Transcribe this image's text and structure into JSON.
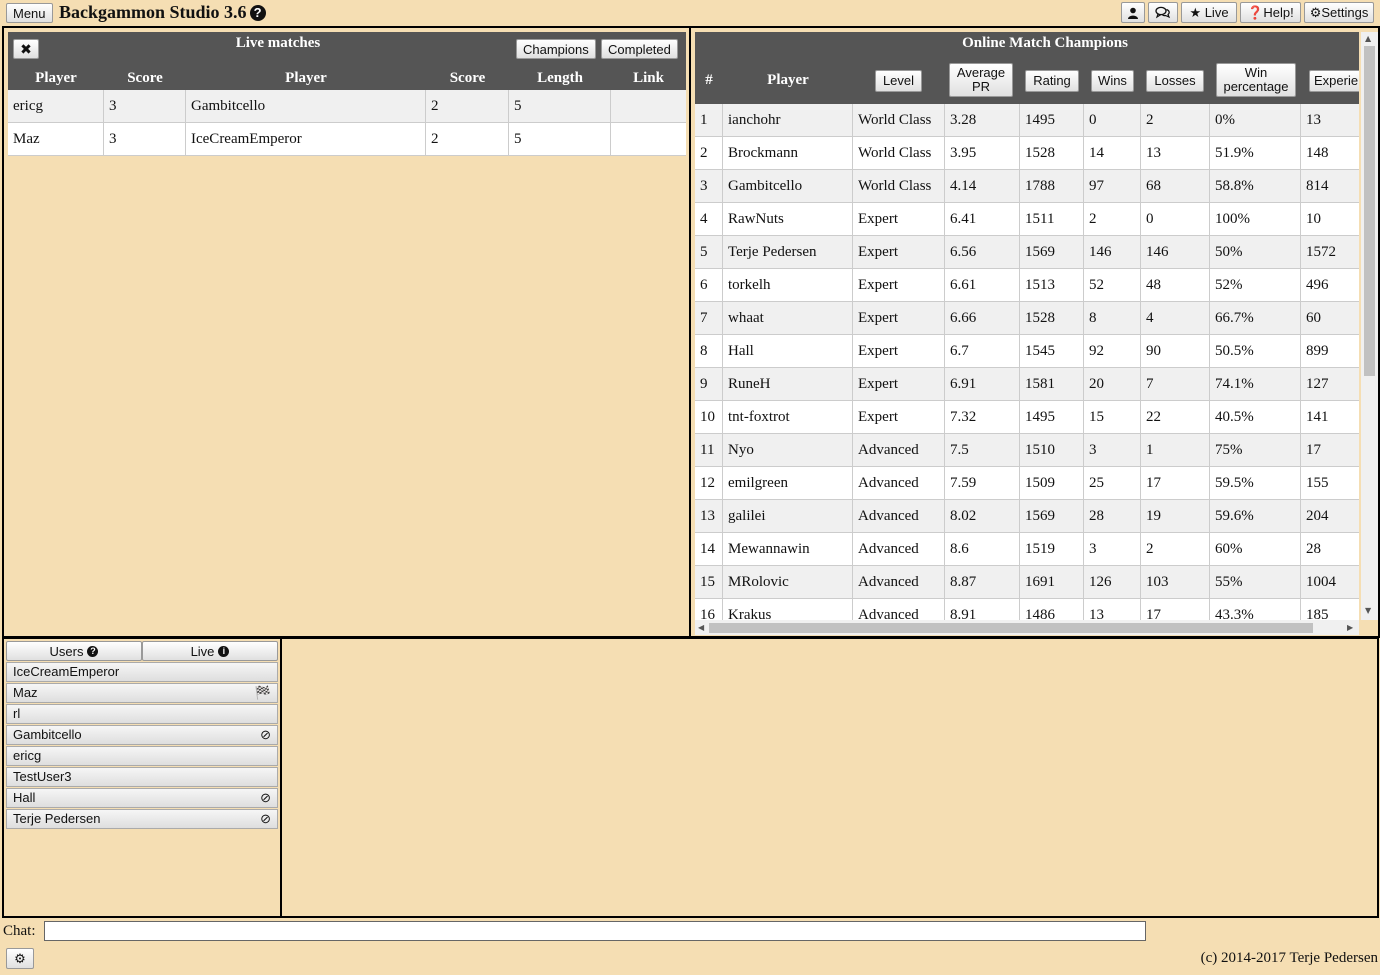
{
  "topbar": {
    "menu_label": "Menu",
    "app_title": "Backgammon Studio 3.6",
    "help_glyph": "?",
    "user_icon": "user-icon",
    "chat_icon": "chat-bubbles-icon",
    "live_label": "★ Live",
    "help_label": "❓Help!",
    "settings_label": "⚙Settings"
  },
  "live_matches": {
    "close_label": "✖",
    "title": "Live matches",
    "champions_label": "Champions",
    "completed_label": "Completed",
    "columns": [
      "Player",
      "Score",
      "Player",
      "Score",
      "Length",
      "Link"
    ],
    "rows": [
      [
        "ericg",
        "3",
        "Gambitcello",
        "2",
        "5",
        ""
      ],
      [
        "Maz",
        "3",
        "IceCreamEmperor",
        "2",
        "5",
        ""
      ]
    ]
  },
  "champions": {
    "title": "Online Match Champions",
    "col_rank": "#",
    "col_player": "Player",
    "btn_level": "Level",
    "btn_avg_pr_1": "Average",
    "btn_avg_pr_2": "PR",
    "btn_rating": "Rating",
    "btn_wins": "Wins",
    "btn_losses": "Losses",
    "btn_winpct_1": "Win",
    "btn_winpct_2": "percentage",
    "btn_experience": "Experie",
    "rows": [
      [
        "1",
        "ianchohr",
        "World Class",
        "3.28",
        "1495",
        "0",
        "2",
        "0%",
        "13"
      ],
      [
        "2",
        "Brockmann",
        "World Class",
        "3.95",
        "1528",
        "14",
        "13",
        "51.9%",
        "148"
      ],
      [
        "3",
        "Gambitcello",
        "World Class",
        "4.14",
        "1788",
        "97",
        "68",
        "58.8%",
        "814"
      ],
      [
        "4",
        "RawNuts",
        "Expert",
        "6.41",
        "1511",
        "2",
        "0",
        "100%",
        "10"
      ],
      [
        "5",
        "Terje Pedersen",
        "Expert",
        "6.56",
        "1569",
        "146",
        "146",
        "50%",
        "1572"
      ],
      [
        "6",
        "torkelh",
        "Expert",
        "6.61",
        "1513",
        "52",
        "48",
        "52%",
        "496"
      ],
      [
        "7",
        "whaat",
        "Expert",
        "6.66",
        "1528",
        "8",
        "4",
        "66.7%",
        "60"
      ],
      [
        "8",
        "Hall",
        "Expert",
        "6.7",
        "1545",
        "92",
        "90",
        "50.5%",
        "899"
      ],
      [
        "9",
        "RuneH",
        "Expert",
        "6.91",
        "1581",
        "20",
        "7",
        "74.1%",
        "127"
      ],
      [
        "10",
        "tnt-foxtrot",
        "Expert",
        "7.32",
        "1495",
        "15",
        "22",
        "40.5%",
        "141"
      ],
      [
        "11",
        "Nyo",
        "Advanced",
        "7.5",
        "1510",
        "3",
        "1",
        "75%",
        "17"
      ],
      [
        "12",
        "emilgreen",
        "Advanced",
        "7.59",
        "1509",
        "25",
        "17",
        "59.5%",
        "155"
      ],
      [
        "13",
        "galilei",
        "Advanced",
        "8.02",
        "1569",
        "28",
        "19",
        "59.6%",
        "204"
      ],
      [
        "14",
        "Mewannawin",
        "Advanced",
        "8.6",
        "1519",
        "3",
        "2",
        "60%",
        "28"
      ],
      [
        "15",
        "MRolovic",
        "Advanced",
        "8.87",
        "1691",
        "126",
        "103",
        "55%",
        "1004"
      ],
      [
        "16",
        "Krakus",
        "Advanced",
        "8.91",
        "1486",
        "13",
        "17",
        "43.3%",
        "185"
      ]
    ]
  },
  "users_panel": {
    "tab_users": "Users",
    "tab_users_icon": "?",
    "tab_live": "Live",
    "tab_live_icon": "i",
    "users": [
      {
        "name": "IceCreamEmperor",
        "icon": ""
      },
      {
        "name": "Maz",
        "icon": "🏁"
      },
      {
        "name": "rl",
        "icon": ""
      },
      {
        "name": "Gambitcello",
        "icon": "⊘"
      },
      {
        "name": "ericg",
        "icon": ""
      },
      {
        "name": "TestUser3",
        "icon": ""
      },
      {
        "name": "Hall",
        "icon": "⊘"
      },
      {
        "name": "Terje Pedersen",
        "icon": "⊘"
      }
    ]
  },
  "chat": {
    "label": "Chat:",
    "value": ""
  },
  "footer": {
    "gear_label": "⚙",
    "copyright": "(c) 2014-2017 Terje Pedersen"
  }
}
